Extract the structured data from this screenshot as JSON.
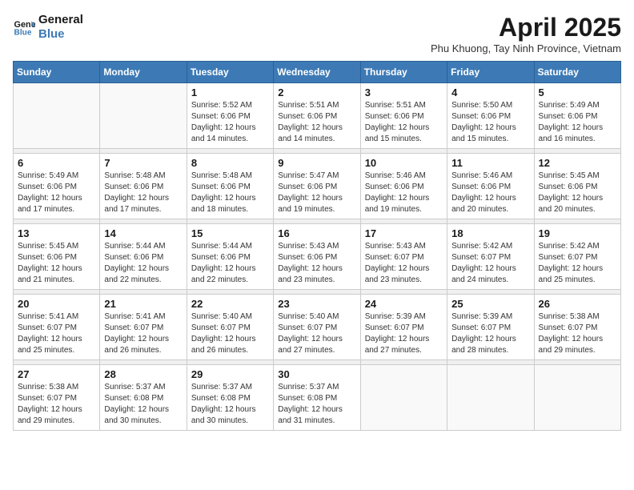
{
  "header": {
    "logo_line1": "General",
    "logo_line2": "Blue",
    "month_title": "April 2025",
    "subtitle": "Phu Khuong, Tay Ninh Province, Vietnam"
  },
  "weekdays": [
    "Sunday",
    "Monday",
    "Tuesday",
    "Wednesday",
    "Thursday",
    "Friday",
    "Saturday"
  ],
  "weeks": [
    [
      {
        "day": "",
        "info": ""
      },
      {
        "day": "",
        "info": ""
      },
      {
        "day": "1",
        "info": "Sunrise: 5:52 AM\nSunset: 6:06 PM\nDaylight: 12 hours\nand 14 minutes."
      },
      {
        "day": "2",
        "info": "Sunrise: 5:51 AM\nSunset: 6:06 PM\nDaylight: 12 hours\nand 14 minutes."
      },
      {
        "day": "3",
        "info": "Sunrise: 5:51 AM\nSunset: 6:06 PM\nDaylight: 12 hours\nand 15 minutes."
      },
      {
        "day": "4",
        "info": "Sunrise: 5:50 AM\nSunset: 6:06 PM\nDaylight: 12 hours\nand 15 minutes."
      },
      {
        "day": "5",
        "info": "Sunrise: 5:49 AM\nSunset: 6:06 PM\nDaylight: 12 hours\nand 16 minutes."
      }
    ],
    [
      {
        "day": "6",
        "info": "Sunrise: 5:49 AM\nSunset: 6:06 PM\nDaylight: 12 hours\nand 17 minutes."
      },
      {
        "day": "7",
        "info": "Sunrise: 5:48 AM\nSunset: 6:06 PM\nDaylight: 12 hours\nand 17 minutes."
      },
      {
        "day": "8",
        "info": "Sunrise: 5:48 AM\nSunset: 6:06 PM\nDaylight: 12 hours\nand 18 minutes."
      },
      {
        "day": "9",
        "info": "Sunrise: 5:47 AM\nSunset: 6:06 PM\nDaylight: 12 hours\nand 19 minutes."
      },
      {
        "day": "10",
        "info": "Sunrise: 5:46 AM\nSunset: 6:06 PM\nDaylight: 12 hours\nand 19 minutes."
      },
      {
        "day": "11",
        "info": "Sunrise: 5:46 AM\nSunset: 6:06 PM\nDaylight: 12 hours\nand 20 minutes."
      },
      {
        "day": "12",
        "info": "Sunrise: 5:45 AM\nSunset: 6:06 PM\nDaylight: 12 hours\nand 20 minutes."
      }
    ],
    [
      {
        "day": "13",
        "info": "Sunrise: 5:45 AM\nSunset: 6:06 PM\nDaylight: 12 hours\nand 21 minutes."
      },
      {
        "day": "14",
        "info": "Sunrise: 5:44 AM\nSunset: 6:06 PM\nDaylight: 12 hours\nand 22 minutes."
      },
      {
        "day": "15",
        "info": "Sunrise: 5:44 AM\nSunset: 6:06 PM\nDaylight: 12 hours\nand 22 minutes."
      },
      {
        "day": "16",
        "info": "Sunrise: 5:43 AM\nSunset: 6:06 PM\nDaylight: 12 hours\nand 23 minutes."
      },
      {
        "day": "17",
        "info": "Sunrise: 5:43 AM\nSunset: 6:07 PM\nDaylight: 12 hours\nand 23 minutes."
      },
      {
        "day": "18",
        "info": "Sunrise: 5:42 AM\nSunset: 6:07 PM\nDaylight: 12 hours\nand 24 minutes."
      },
      {
        "day": "19",
        "info": "Sunrise: 5:42 AM\nSunset: 6:07 PM\nDaylight: 12 hours\nand 25 minutes."
      }
    ],
    [
      {
        "day": "20",
        "info": "Sunrise: 5:41 AM\nSunset: 6:07 PM\nDaylight: 12 hours\nand 25 minutes."
      },
      {
        "day": "21",
        "info": "Sunrise: 5:41 AM\nSunset: 6:07 PM\nDaylight: 12 hours\nand 26 minutes."
      },
      {
        "day": "22",
        "info": "Sunrise: 5:40 AM\nSunset: 6:07 PM\nDaylight: 12 hours\nand 26 minutes."
      },
      {
        "day": "23",
        "info": "Sunrise: 5:40 AM\nSunset: 6:07 PM\nDaylight: 12 hours\nand 27 minutes."
      },
      {
        "day": "24",
        "info": "Sunrise: 5:39 AM\nSunset: 6:07 PM\nDaylight: 12 hours\nand 27 minutes."
      },
      {
        "day": "25",
        "info": "Sunrise: 5:39 AM\nSunset: 6:07 PM\nDaylight: 12 hours\nand 28 minutes."
      },
      {
        "day": "26",
        "info": "Sunrise: 5:38 AM\nSunset: 6:07 PM\nDaylight: 12 hours\nand 29 minutes."
      }
    ],
    [
      {
        "day": "27",
        "info": "Sunrise: 5:38 AM\nSunset: 6:07 PM\nDaylight: 12 hours\nand 29 minutes."
      },
      {
        "day": "28",
        "info": "Sunrise: 5:37 AM\nSunset: 6:08 PM\nDaylight: 12 hours\nand 30 minutes."
      },
      {
        "day": "29",
        "info": "Sunrise: 5:37 AM\nSunset: 6:08 PM\nDaylight: 12 hours\nand 30 minutes."
      },
      {
        "day": "30",
        "info": "Sunrise: 5:37 AM\nSunset: 6:08 PM\nDaylight: 12 hours\nand 31 minutes."
      },
      {
        "day": "",
        "info": ""
      },
      {
        "day": "",
        "info": ""
      },
      {
        "day": "",
        "info": ""
      }
    ]
  ]
}
